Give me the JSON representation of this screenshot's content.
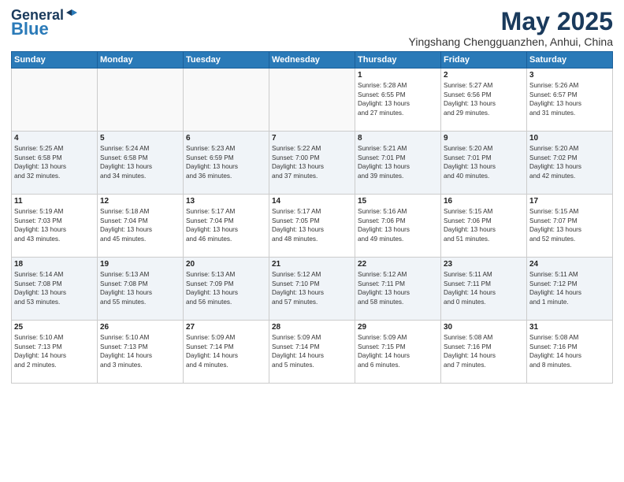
{
  "header": {
    "logo_general": "General",
    "logo_blue": "Blue",
    "title": "May 2025",
    "subtitle": "Yingshang Chengguanzhen, Anhui, China"
  },
  "weekdays": [
    "Sunday",
    "Monday",
    "Tuesday",
    "Wednesday",
    "Thursday",
    "Friday",
    "Saturday"
  ],
  "weeks": [
    [
      {
        "day": "",
        "text": ""
      },
      {
        "day": "",
        "text": ""
      },
      {
        "day": "",
        "text": ""
      },
      {
        "day": "",
        "text": ""
      },
      {
        "day": "1",
        "text": "Sunrise: 5:28 AM\nSunset: 6:55 PM\nDaylight: 13 hours\nand 27 minutes."
      },
      {
        "day": "2",
        "text": "Sunrise: 5:27 AM\nSunset: 6:56 PM\nDaylight: 13 hours\nand 29 minutes."
      },
      {
        "day": "3",
        "text": "Sunrise: 5:26 AM\nSunset: 6:57 PM\nDaylight: 13 hours\nand 31 minutes."
      }
    ],
    [
      {
        "day": "4",
        "text": "Sunrise: 5:25 AM\nSunset: 6:58 PM\nDaylight: 13 hours\nand 32 minutes."
      },
      {
        "day": "5",
        "text": "Sunrise: 5:24 AM\nSunset: 6:58 PM\nDaylight: 13 hours\nand 34 minutes."
      },
      {
        "day": "6",
        "text": "Sunrise: 5:23 AM\nSunset: 6:59 PM\nDaylight: 13 hours\nand 36 minutes."
      },
      {
        "day": "7",
        "text": "Sunrise: 5:22 AM\nSunset: 7:00 PM\nDaylight: 13 hours\nand 37 minutes."
      },
      {
        "day": "8",
        "text": "Sunrise: 5:21 AM\nSunset: 7:01 PM\nDaylight: 13 hours\nand 39 minutes."
      },
      {
        "day": "9",
        "text": "Sunrise: 5:20 AM\nSunset: 7:01 PM\nDaylight: 13 hours\nand 40 minutes."
      },
      {
        "day": "10",
        "text": "Sunrise: 5:20 AM\nSunset: 7:02 PM\nDaylight: 13 hours\nand 42 minutes."
      }
    ],
    [
      {
        "day": "11",
        "text": "Sunrise: 5:19 AM\nSunset: 7:03 PM\nDaylight: 13 hours\nand 43 minutes."
      },
      {
        "day": "12",
        "text": "Sunrise: 5:18 AM\nSunset: 7:04 PM\nDaylight: 13 hours\nand 45 minutes."
      },
      {
        "day": "13",
        "text": "Sunrise: 5:17 AM\nSunset: 7:04 PM\nDaylight: 13 hours\nand 46 minutes."
      },
      {
        "day": "14",
        "text": "Sunrise: 5:17 AM\nSunset: 7:05 PM\nDaylight: 13 hours\nand 48 minutes."
      },
      {
        "day": "15",
        "text": "Sunrise: 5:16 AM\nSunset: 7:06 PM\nDaylight: 13 hours\nand 49 minutes."
      },
      {
        "day": "16",
        "text": "Sunrise: 5:15 AM\nSunset: 7:06 PM\nDaylight: 13 hours\nand 51 minutes."
      },
      {
        "day": "17",
        "text": "Sunrise: 5:15 AM\nSunset: 7:07 PM\nDaylight: 13 hours\nand 52 minutes."
      }
    ],
    [
      {
        "day": "18",
        "text": "Sunrise: 5:14 AM\nSunset: 7:08 PM\nDaylight: 13 hours\nand 53 minutes."
      },
      {
        "day": "19",
        "text": "Sunrise: 5:13 AM\nSunset: 7:08 PM\nDaylight: 13 hours\nand 55 minutes."
      },
      {
        "day": "20",
        "text": "Sunrise: 5:13 AM\nSunset: 7:09 PM\nDaylight: 13 hours\nand 56 minutes."
      },
      {
        "day": "21",
        "text": "Sunrise: 5:12 AM\nSunset: 7:10 PM\nDaylight: 13 hours\nand 57 minutes."
      },
      {
        "day": "22",
        "text": "Sunrise: 5:12 AM\nSunset: 7:11 PM\nDaylight: 13 hours\nand 58 minutes."
      },
      {
        "day": "23",
        "text": "Sunrise: 5:11 AM\nSunset: 7:11 PM\nDaylight: 14 hours\nand 0 minutes."
      },
      {
        "day": "24",
        "text": "Sunrise: 5:11 AM\nSunset: 7:12 PM\nDaylight: 14 hours\nand 1 minute."
      }
    ],
    [
      {
        "day": "25",
        "text": "Sunrise: 5:10 AM\nSunset: 7:13 PM\nDaylight: 14 hours\nand 2 minutes."
      },
      {
        "day": "26",
        "text": "Sunrise: 5:10 AM\nSunset: 7:13 PM\nDaylight: 14 hours\nand 3 minutes."
      },
      {
        "day": "27",
        "text": "Sunrise: 5:09 AM\nSunset: 7:14 PM\nDaylight: 14 hours\nand 4 minutes."
      },
      {
        "day": "28",
        "text": "Sunrise: 5:09 AM\nSunset: 7:14 PM\nDaylight: 14 hours\nand 5 minutes."
      },
      {
        "day": "29",
        "text": "Sunrise: 5:09 AM\nSunset: 7:15 PM\nDaylight: 14 hours\nand 6 minutes."
      },
      {
        "day": "30",
        "text": "Sunrise: 5:08 AM\nSunset: 7:16 PM\nDaylight: 14 hours\nand 7 minutes."
      },
      {
        "day": "31",
        "text": "Sunrise: 5:08 AM\nSunset: 7:16 PM\nDaylight: 14 hours\nand 8 minutes."
      }
    ]
  ]
}
